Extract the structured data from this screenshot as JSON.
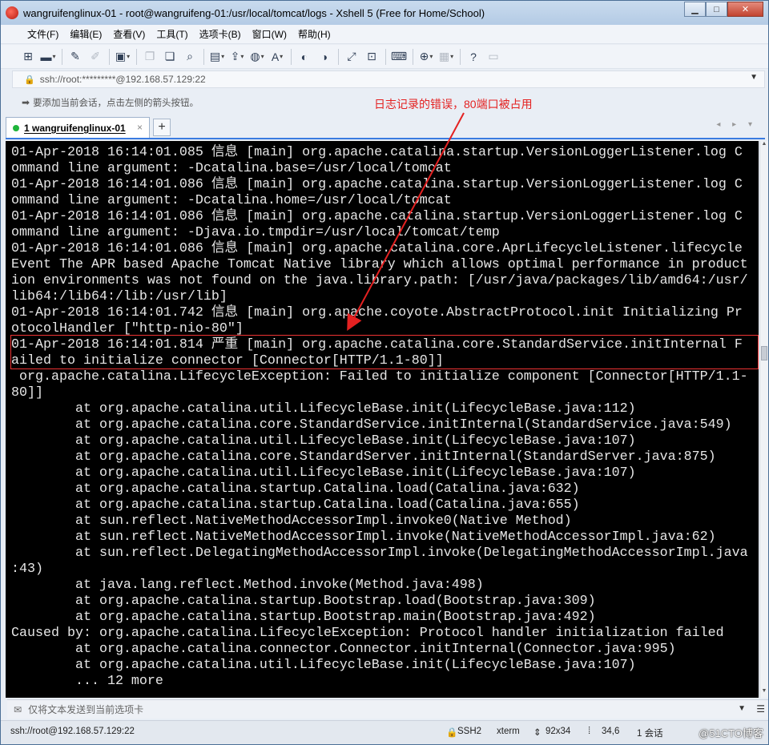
{
  "window": {
    "title": "wangruifenglinux-01 - root@wangruifeng-01:/usr/local/tomcat/logs - Xshell 5 (Free for Home/School)",
    "controls": {
      "minimize": "▁",
      "maximize": "□",
      "close": "✕"
    }
  },
  "menu": [
    {
      "label": "文件(F)"
    },
    {
      "label": "编辑(E)"
    },
    {
      "label": "查看(V)"
    },
    {
      "label": "工具(T)"
    },
    {
      "label": "选项卡(B)"
    },
    {
      "label": "窗口(W)"
    },
    {
      "label": "帮助(H)"
    }
  ],
  "address": {
    "value": "ssh://root:*********@192.168.57.129:22",
    "lock": "🔒"
  },
  "hint": {
    "text": "要添加当前会话，点击左侧的箭头按钮。"
  },
  "annotation": "日志记录的错误，80端口被占用",
  "tabs": [
    {
      "label": "1 wangruifenglinux-01",
      "close": "×"
    }
  ],
  "tab_add": "+",
  "tab_nav": "◂ ▸ ▾",
  "terminal": {
    "lines": [
      "01-Apr-2018 16:14:01.085 信息 [main] org.apache.catalina.startup.VersionLoggerListener.log C",
      "ommand line argument: -Dcatalina.base=/usr/local/tomcat",
      "01-Apr-2018 16:14:01.086 信息 [main] org.apache.catalina.startup.VersionLoggerListener.log C",
      "ommand line argument: -Dcatalina.home=/usr/local/tomcat",
      "01-Apr-2018 16:14:01.086 信息 [main] org.apache.catalina.startup.VersionLoggerListener.log C",
      "ommand line argument: -Djava.io.tmpdir=/usr/local/tomcat/temp",
      "01-Apr-2018 16:14:01.086 信息 [main] org.apache.catalina.core.AprLifecycleListener.lifecycle",
      "Event The APR based Apache Tomcat Native library which allows optimal performance in product",
      "ion environments was not found on the java.library.path: [/usr/java/packages/lib/amd64:/usr/",
      "lib64:/lib64:/lib:/usr/lib]",
      "01-Apr-2018 16:14:01.742 信息 [main] org.apache.coyote.AbstractProtocol.init Initializing Pr",
      "otocolHandler [\"http-nio-80\"]",
      "01-Apr-2018 16:14:01.814 严重 [main] org.apache.catalina.core.StandardService.initInternal F",
      "ailed to initialize connector [Connector[HTTP/1.1-80]]",
      " org.apache.catalina.LifecycleException: Failed to initialize component [Connector[HTTP/1.1-",
      "80]]",
      "        at org.apache.catalina.util.LifecycleBase.init(LifecycleBase.java:112)",
      "        at org.apache.catalina.core.StandardService.initInternal(StandardService.java:549)",
      "        at org.apache.catalina.util.LifecycleBase.init(LifecycleBase.java:107)",
      "        at org.apache.catalina.core.StandardServer.initInternal(StandardServer.java:875)",
      "        at org.apache.catalina.util.LifecycleBase.init(LifecycleBase.java:107)",
      "        at org.apache.catalina.startup.Catalina.load(Catalina.java:632)",
      "        at org.apache.catalina.startup.Catalina.load(Catalina.java:655)",
      "        at sun.reflect.NativeMethodAccessorImpl.invoke0(Native Method)",
      "        at sun.reflect.NativeMethodAccessorImpl.invoke(NativeMethodAccessorImpl.java:62)",
      "        at sun.reflect.DelegatingMethodAccessorImpl.invoke(DelegatingMethodAccessorImpl.java",
      ":43)",
      "        at java.lang.reflect.Method.invoke(Method.java:498)",
      "        at org.apache.catalina.startup.Bootstrap.load(Bootstrap.java:309)",
      "        at org.apache.catalina.startup.Bootstrap.main(Bootstrap.java:492)",
      "Caused by: org.apache.catalina.LifecycleException: Protocol handler initialization failed",
      "        at org.apache.catalina.connector.Connector.initInternal(Connector.java:995)",
      "        at org.apache.catalina.util.LifecycleBase.init(LifecycleBase.java:107)",
      "        ... 12 more"
    ]
  },
  "sendbar": {
    "text": "仅将文本发送到当前选项卡"
  },
  "status": {
    "connection": "ssh://root@192.168.57.129:22",
    "protocol": "SSH2",
    "term": "xterm",
    "size": "92x34",
    "cursor": "34,6",
    "sessions": "1 会话",
    "watermark": "@51CTO博客"
  },
  "colors": {
    "annotation": "#e42121",
    "terminal_bg": "#000000",
    "terminal_fg": "#e6e6e6",
    "tab_accent": "#3a7be0"
  }
}
